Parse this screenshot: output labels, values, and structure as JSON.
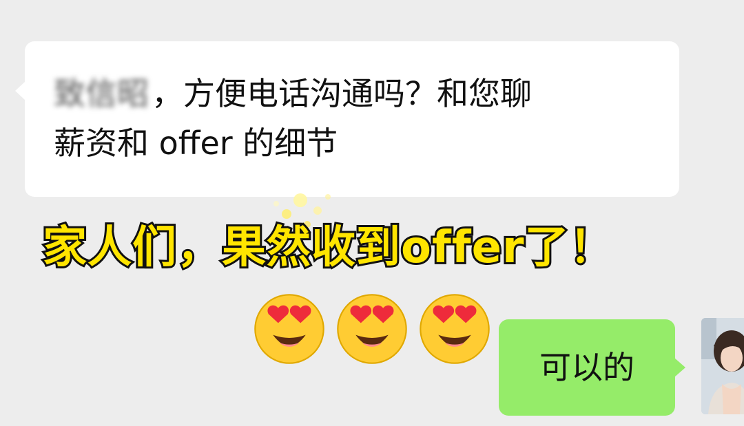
{
  "incoming_message": {
    "sender_name_blurred": "致信昭",
    "line1": "，方便电话沟通吗？和您聊",
    "line2": "薪资和 offer 的细节"
  },
  "caption": {
    "text": "家人们，果然收到offer了！"
  },
  "emojis": {
    "count": 3,
    "name": "smiling-face-with-heart-eyes"
  },
  "outgoing_message": {
    "text": "可以的"
  },
  "colors": {
    "background": "#ededed",
    "incoming_bubble": "#ffffff",
    "outgoing_bubble": "#95ec69",
    "caption_fill": "#ffe500",
    "caption_stroke": "#111111"
  }
}
